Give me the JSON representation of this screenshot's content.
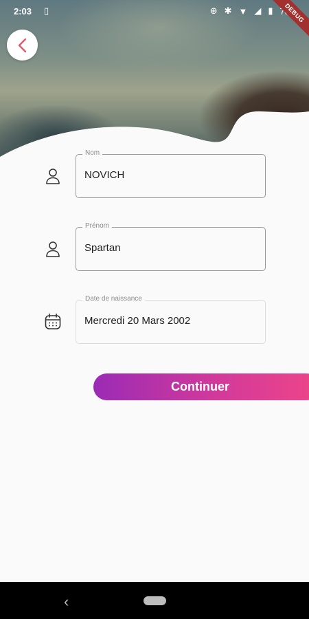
{
  "status_bar": {
    "time": "2:03",
    "battery": "78"
  },
  "debug_banner": {
    "label": "DEBUG"
  },
  "form": {
    "nom": {
      "label": "Nom",
      "value": "NOVICH"
    },
    "prenom": {
      "label": "Prénom",
      "value": "Spartan"
    },
    "date_naissance": {
      "label": "Date de naissance",
      "value": "Mercredi 20 Mars 2002"
    }
  },
  "continue_button": {
    "label": "Continuer"
  },
  "colors": {
    "accent_start": "#9b2bb5",
    "accent_end": "#ee4588",
    "back_arrow": "#e05a6a"
  },
  "icons": {
    "back": "chevron-left-icon",
    "nom": "person-icon",
    "prenom": "person-icon",
    "date": "calendar-icon"
  }
}
